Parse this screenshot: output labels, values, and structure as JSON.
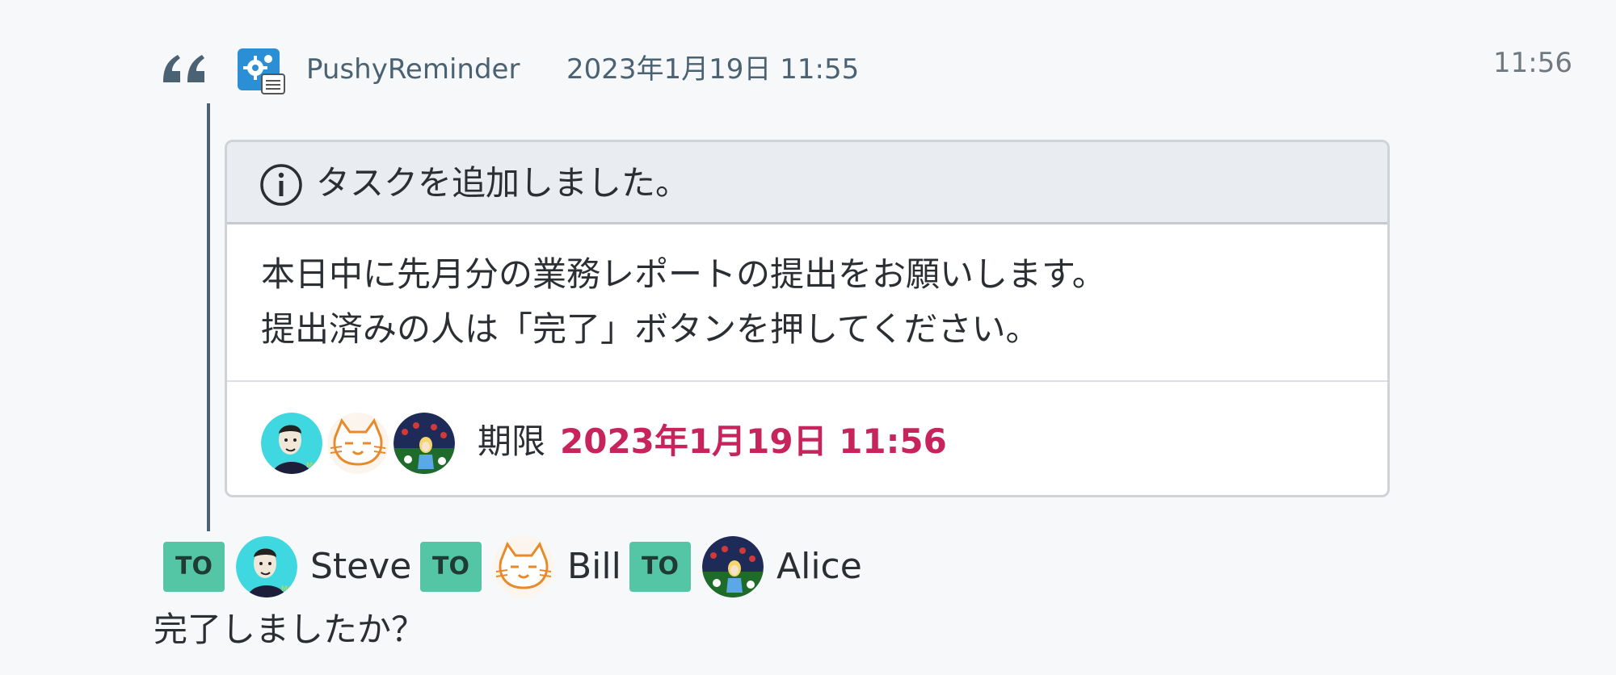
{
  "quote": {
    "sender_name": "PushyReminder",
    "sent_time": "2023年1月19日 11:55",
    "bot_icon": "gear-app-icon",
    "quote_icon": "quote-mark-icon"
  },
  "message_time": "11:56",
  "task": {
    "header_icon": "info-icon",
    "header_title": "タスクを追加しました。",
    "body_line1": "本日中に先月分の業務レポートの提出をお願いします。",
    "body_line2": "提出済みの人は「完了」ボタンを押してください。",
    "assignees": [
      "Steve",
      "Bill",
      "Alice"
    ],
    "deadline_label": "期限",
    "deadline_value": "2023年1月19日 11:56",
    "deadline_color": "#c8245c"
  },
  "mentions": [
    {
      "badge": "TO",
      "name": "Steve"
    },
    {
      "badge": "TO",
      "name": "Bill"
    },
    {
      "badge": "TO",
      "name": "Alice"
    }
  ],
  "reply_text": "完了しましたか？",
  "colors": {
    "background": "#f7f8fa",
    "accent_link": "#4a6272",
    "to_badge": "#55c6a5",
    "card_header": "#e9ecf0"
  }
}
